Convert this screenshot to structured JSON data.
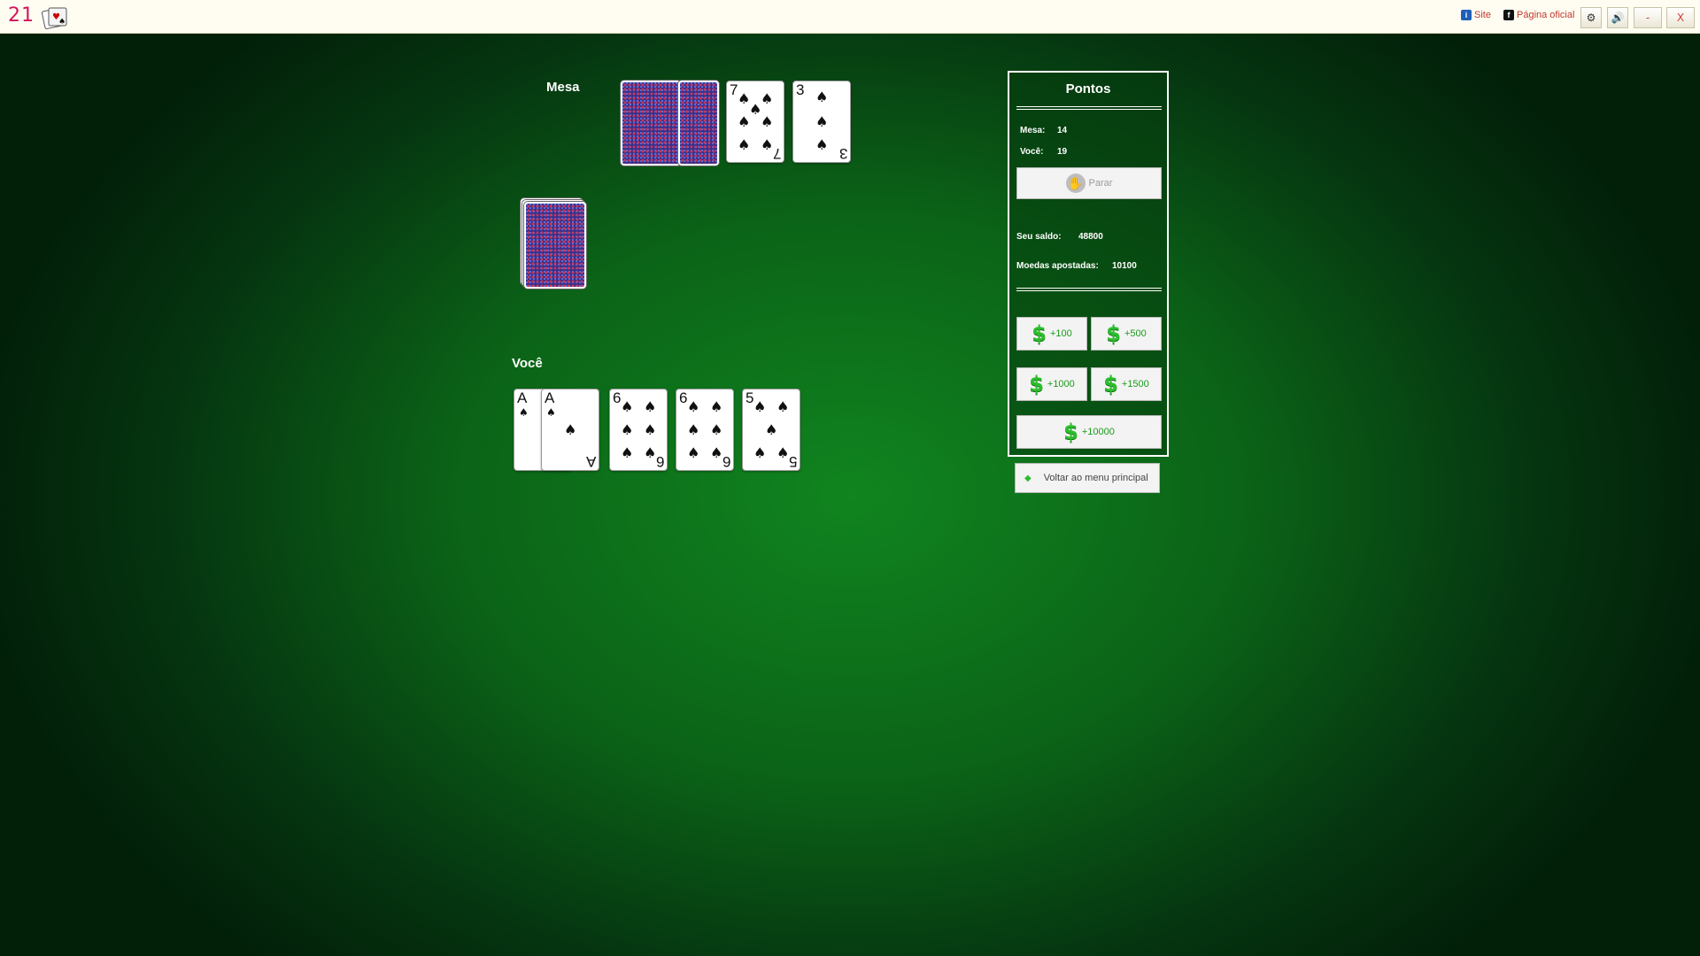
{
  "topbar": {
    "logo": "21",
    "app_icon": "cards-icon",
    "site_label": "Site",
    "official_page_label": "Página oficial",
    "settings_icon": "gear-icon",
    "sound_icon": "speaker-icon",
    "minimize_label": "-",
    "close_label": "X"
  },
  "table": {
    "dealer_label": "Mesa",
    "player_label": "Você",
    "dealer_cards": [
      {
        "face": "back"
      },
      {
        "face": "back"
      },
      {
        "rank": "7",
        "suit": "♠"
      },
      {
        "rank": "3",
        "suit": "♠"
      }
    ],
    "player_cards": [
      {
        "rank": "A",
        "suit": "♠"
      },
      {
        "rank": "A",
        "suit": "♠"
      },
      {
        "rank": "6",
        "suit": "♠"
      },
      {
        "rank": "6",
        "suit": "♠"
      },
      {
        "rank": "5",
        "suit": "♠"
      }
    ]
  },
  "panel": {
    "title": "Pontos",
    "dealer_points_label": "Mesa:",
    "dealer_points": "14",
    "player_points_label": "Você:",
    "player_points": "19",
    "stand_label": "Parar",
    "balance_label": "Seu saldo:",
    "balance": "48800",
    "bet_label": "Moedas apostadas:",
    "bet": "10100",
    "bet_buttons": [
      "+100",
      "+500",
      "+1000",
      "+1500",
      "+10000"
    ],
    "back_menu_label": "Voltar ao menu principal"
  },
  "colors": {
    "felt": "#0b6317",
    "accent": "#2dbd2d",
    "logo": "#d4145a"
  }
}
